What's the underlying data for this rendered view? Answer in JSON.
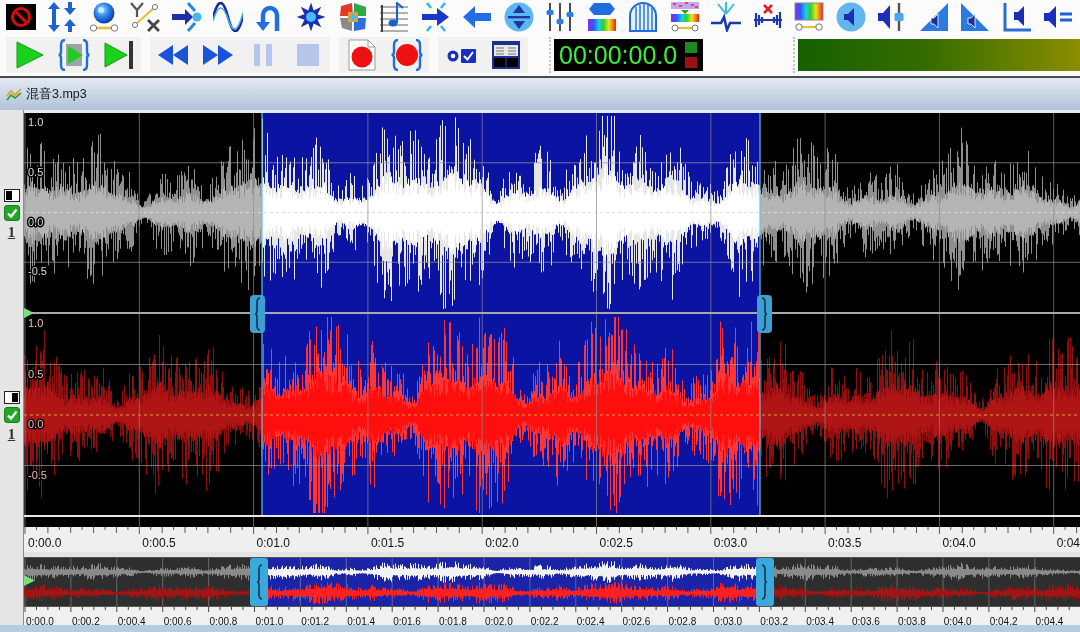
{
  "transport_toolbar": [
    {
      "buttons": [
        {
          "kind": "play",
          "disabled": false
        },
        {
          "kind": "play_selection",
          "disabled": false
        },
        {
          "kind": "play_to_end",
          "disabled": false
        }
      ]
    },
    {
      "buttons": [
        {
          "kind": "rewind",
          "disabled": false
        },
        {
          "kind": "fast_forward",
          "disabled": false
        },
        {
          "kind": "pause",
          "disabled": true
        },
        {
          "kind": "stop",
          "disabled": true
        }
      ]
    },
    {
      "buttons": [
        {
          "kind": "record_new",
          "disabled": false
        },
        {
          "kind": "record_selection",
          "disabled": false
        }
      ]
    },
    {
      "buttons": [
        {
          "kind": "options",
          "disabled": false
        },
        {
          "kind": "window",
          "disabled": false
        }
      ]
    }
  ],
  "time_display": {
    "value": "00:00:00.0"
  },
  "file_tab": {
    "title": "混音3.mp3"
  },
  "channels": [
    {
      "kind": "left",
      "number": "1",
      "enabled": true,
      "axis_labels": [
        "1.0",
        "0.5",
        "0.0",
        "-0.5"
      ]
    },
    {
      "kind": "right",
      "number": "1",
      "enabled": true,
      "axis_labels": [
        "1.0",
        "0.5",
        "0.0",
        "-0.5"
      ]
    }
  ],
  "time_ruler": {
    "labels": [
      "0:00.0",
      "0:00.5",
      "0:01.0",
      "0:01.5",
      "0:02.0",
      "0:02.5",
      "0:03.0",
      "0:03.5",
      "0:04.0",
      "0:04"
    ]
  },
  "overview_ruler": {
    "labels": [
      "0:00.0",
      "0:00.2",
      "0:00.4",
      "0:00.6",
      "0:00.8",
      "0:01.0",
      "0:01.2",
      "0:01.4",
      "0:01.6",
      "0:01.8",
      "0:02.0",
      "0:02.2",
      "0:02.4",
      "0:02.6",
      "0:02.8",
      "0:03.0",
      "0:03.2",
      "0:03.4",
      "0:03.6",
      "0:03.8",
      "0:04.0",
      "0:04.2",
      "0:04.4"
    ]
  }
}
